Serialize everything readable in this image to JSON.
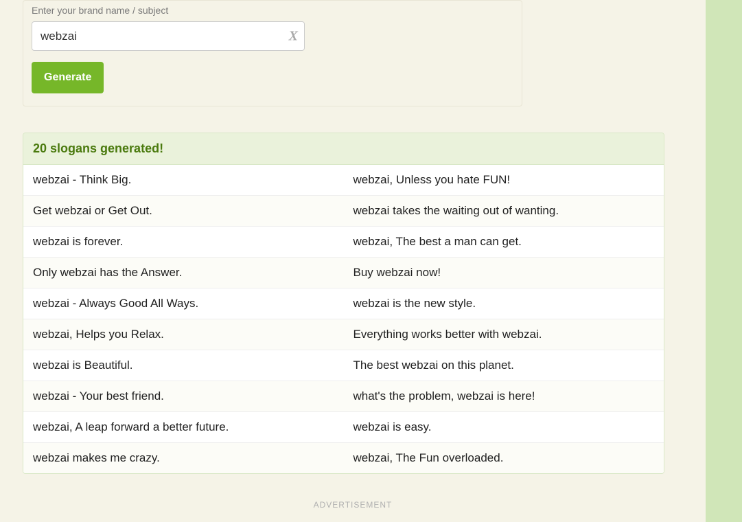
{
  "form": {
    "label": "Enter your brand name / subject",
    "input_value": "webzai",
    "generate_label": "Generate"
  },
  "results": {
    "header": "20 slogans generated!",
    "rows": [
      {
        "left": "webzai - Think Big.",
        "right": "webzai, Unless you hate FUN!"
      },
      {
        "left": "Get webzai or Get Out.",
        "right": "webzai takes the waiting out of wanting."
      },
      {
        "left": "webzai is forever.",
        "right": "webzai, The best a man can get."
      },
      {
        "left": "Only webzai has the Answer.",
        "right": "Buy webzai now!"
      },
      {
        "left": "webzai - Always Good All Ways.",
        "right": "webzai is the new style."
      },
      {
        "left": "webzai, Helps you Relax.",
        "right": "Everything works better with webzai."
      },
      {
        "left": "webzai is Beautiful.",
        "right": "The best webzai on this planet."
      },
      {
        "left": "webzai - Your best friend.",
        "right": "what's the problem, webzai is here!"
      },
      {
        "left": "webzai, A leap forward a better future.",
        "right": "webzai is easy."
      },
      {
        "left": "webzai makes me crazy.",
        "right": "webzai, The Fun overloaded."
      }
    ]
  },
  "ad_label": "ADVERTISEMENT"
}
